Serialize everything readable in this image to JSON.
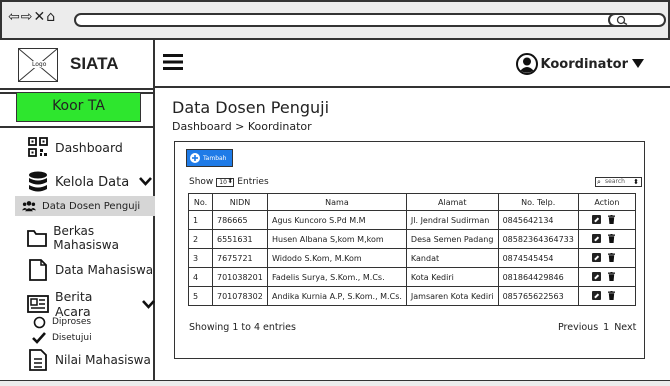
{
  "browser": {
    "nav_icons": "⇦⇨✕⌂"
  },
  "brand": {
    "logo_text": "Logo",
    "name": "SIATA"
  },
  "role": {
    "label": "Koor TA"
  },
  "sidebar": {
    "items": [
      {
        "label": "Dashboard",
        "icon": "qr-dashboard-icon"
      },
      {
        "label": "Kelola Data",
        "icon": "database-icon"
      },
      {
        "label": "Data Dosen Penguji",
        "icon": "users-icon"
      },
      {
        "label": "Berkas Mahasiswa",
        "icon": "folder-icon"
      },
      {
        "label": "Data Mahasiswa",
        "icon": "file-icon"
      },
      {
        "label": "Berita Acara",
        "icon": "news-icon"
      },
      {
        "label": "Diproses",
        "icon": "circle-icon"
      },
      {
        "label": "Disetujui",
        "icon": "check-icon"
      },
      {
        "label": "Nilai Mahasiswa",
        "icon": "document-icon"
      }
    ]
  },
  "topbar": {
    "user_label": "Koordinator"
  },
  "page": {
    "title": "Data Dosen Penguji",
    "breadcrumb": "Dashboard > Koordinator"
  },
  "table_controls": {
    "add_label": "Tambah",
    "show_prefix": "Show",
    "show_value": "10",
    "show_suffix": "Entries",
    "search_placeholder": "search"
  },
  "table": {
    "headers": [
      "No.",
      "NIDN",
      "Nama",
      "Alamat",
      "No. Telp.",
      "Action"
    ],
    "rows": [
      [
        "1",
        "786665",
        "Agus Kuncoro S.Pd M.M",
        "Jl. Jendral Sudirman",
        "0845642134"
      ],
      [
        "2",
        "6551631",
        "Husen Albana S,kom M,kom",
        "Desa Semen Padang",
        "08582364364733"
      ],
      [
        "3",
        "7675721",
        "Widodo S.Kom, M.Kom",
        "Kandat",
        "0874545454"
      ],
      [
        "4",
        "701038201",
        "Fadelis Surya, S.Kom., M.Cs.",
        "Kota Kediri",
        "081864429846"
      ],
      [
        "5",
        "701078302",
        "Andika Kurnia A.P, S.Kom., M.Cs.",
        "Jamsaren Kota Kediri",
        "085765622563"
      ]
    ]
  },
  "footer": {
    "showing": "Showing 1 to 4 entries",
    "prev": "Previous",
    "page": "1",
    "next": "Next"
  },
  "colors": {
    "role_btn": "#2ee62e",
    "add_btn": "#1f7be7"
  }
}
